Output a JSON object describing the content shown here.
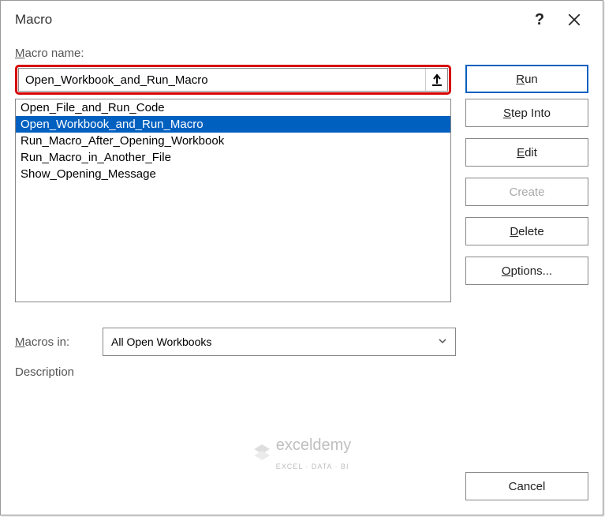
{
  "dialog": {
    "title": "Macro",
    "help_glyph": "?",
    "name_label_pre": "M",
    "name_label_post": "acro name:",
    "macro_name_value": "Open_Workbook_and_Run_Macro",
    "scope_label_pre": "M",
    "scope_label_post": "acros in:",
    "scope_value": "All Open Workbooks",
    "description_label": "Description"
  },
  "macros": {
    "items": [
      {
        "label": "Open_File_and_Run_Code"
      },
      {
        "label": "Open_Workbook_and_Run_Macro"
      },
      {
        "label": "Run_Macro_After_Opening_Workbook"
      },
      {
        "label": "Run_Macro_in_Another_File"
      },
      {
        "label": "Show_Opening_Message"
      }
    ],
    "selected_index": 1
  },
  "buttons": {
    "run_pre": "R",
    "run_post": "un",
    "stepinto_pre": "S",
    "stepinto_post": "tep Into",
    "edit_pre": "E",
    "edit_post": "dit",
    "create": "Create",
    "delete_pre": "D",
    "delete_post": "elete",
    "options_pre": "O",
    "options_post": "ptions...",
    "cancel": "Cancel"
  },
  "watermark": {
    "text": "exceldemy",
    "sub": "EXCEL · DATA · BI"
  }
}
